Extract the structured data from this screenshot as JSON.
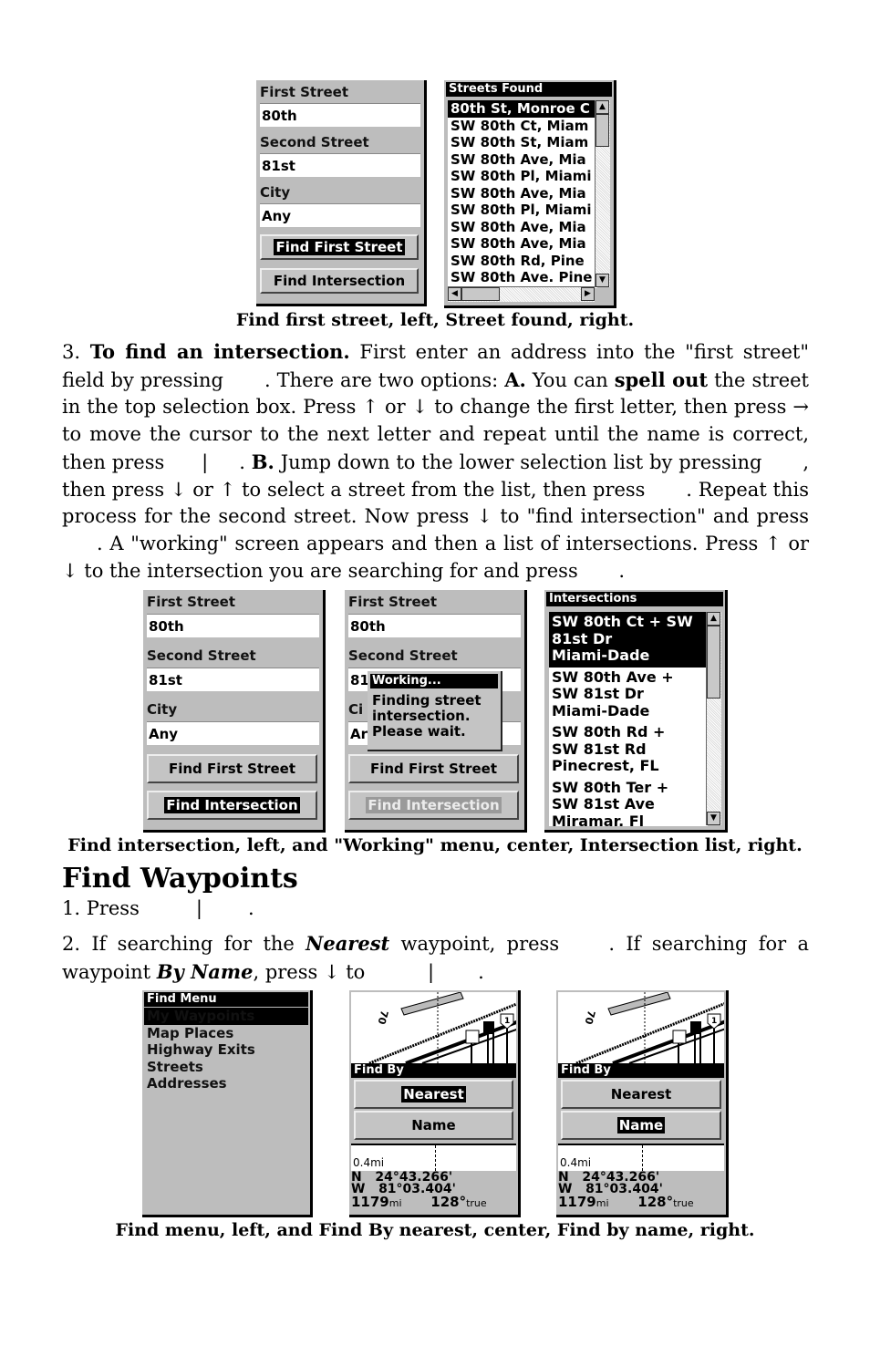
{
  "figure1": {
    "left_screen": {
      "first_street_label": "First Street",
      "first_street_value": "80th",
      "second_street_label": "Second Street",
      "second_street_value": "81st",
      "city_label": "City",
      "city_value": "Any",
      "find_first_street_button": "Find First Street",
      "find_intersection_button": "Find Intersection",
      "highlighted": "Find First Street"
    },
    "right_screen": {
      "title": "Streets Found",
      "items": [
        "80th St, Monroe C",
        "SW 80th Ct, Miam",
        "SW 80th St, Miam",
        "SW 80th Ave, Mia",
        "SW 80th Pl, Miami",
        "SW 80th Ave, Mia",
        "SW 80th Pl, Miami",
        "SW 80th Ave, Mia",
        "SW 80th Ave, Mia",
        "SW 80th Rd, Pine",
        "SW 80th Ave. Pine"
      ],
      "selected_index": 0
    },
    "caption": "Find first street, left, Street found, right."
  },
  "step3": {
    "number": "3.",
    "bold_intro": "To find an intersection.",
    "t1": " First enter an address into the \"first street\" field by pressing ",
    "t2": ". There are two options: ",
    "a_label": "A.",
    "t3": " You can ",
    "spell_out": "spell out",
    "t4": " the street in the top selection box. Press ↑ or ↓ to change the first letter, then press → to move the cursor to the next letter and repeat until the name is correct, then press ",
    "sep": "|",
    "t5": ". ",
    "b_label": "B.",
    "t6": " Jump down to the lower selection list by pressing ",
    "t7": ", then press ↓ or ↑ to select a street from the list, then press ",
    "t8": ". Repeat this process for the second street. Now press ↓ to \"find intersection\" and press ",
    "t9": ". A \"working\" screen appears and then a list of intersections. Press ↑ or ↓ to the intersection you are searching for and press ",
    "t10": "."
  },
  "figure2": {
    "left_screen": {
      "first_street_label": "First Street",
      "first_street_value": "80th",
      "second_street_label": "Second Street",
      "second_street_value": "81st",
      "city_label": "City",
      "city_value": "Any",
      "find_first_street_button": "Find First Street",
      "find_intersection_button": "Find Intersection",
      "highlighted": "Find Intersection"
    },
    "center_screen": {
      "first_street_label": "First Street",
      "first_street_value": "80th",
      "second_street_label": "Second Street",
      "second_street_value_partial": "81",
      "city_label_partial": "Ci",
      "city_value_partial": "Ar",
      "find_first_street_button": "Find First Street",
      "find_intersection_button": "Find Intersection",
      "dialog_title": "Working...",
      "dialog_lines": [
        "Finding street",
        "intersection.",
        "Please wait."
      ]
    },
    "right_screen": {
      "title": "Intersections",
      "items": [
        [
          "SW 80th Ct + SW",
          "81st Dr",
          "Miami-Dade"
        ],
        [
          "SW 80th Ave +",
          "SW 81st Dr",
          "Miami-Dade"
        ],
        [
          "SW 80th Rd +",
          "SW 81st Rd",
          "Pinecrest, FL"
        ],
        [
          "SW 80th Ter +",
          "SW 81st Ave",
          "Miramar, Fl"
        ]
      ],
      "selected_index": 0
    },
    "caption": "Find intersection, left, and \"Working\" menu, center, Intersection list, right."
  },
  "section": {
    "heading": "Find Waypoints",
    "step1_pre": "1. Press",
    "step1_sep": "|",
    "step1_end": ".",
    "step2_pre": "2. If searching for the ",
    "step2_nearest": "Nearest",
    "step2_mid": " waypoint, press ",
    "step2_mid2": ". If searching for a waypoint ",
    "step2_byname": "By Name",
    "step2_end": ", press ↓ to ",
    "step2_sep": "|",
    "step2_dot": "."
  },
  "figure3": {
    "left_screen": {
      "title": "Find Menu",
      "items": [
        "My Waypoints",
        "Map Places",
        "Highway Exits",
        "Streets",
        "Addresses"
      ],
      "selected_index": 0
    },
    "center_screen": {
      "map_label": "0.4mi",
      "find_by_title": "Find By",
      "options": [
        "Nearest",
        "Name"
      ],
      "selected": "Nearest",
      "lat": "N   24°43.266'",
      "lon": "W   81°03.404'",
      "distance": "1179",
      "distance_unit": "mi",
      "bearing": "128°",
      "bearing_unit": "true"
    },
    "right_screen": {
      "map_label": "0.4mi",
      "find_by_title": "Find By",
      "options": [
        "Nearest",
        "Name"
      ],
      "selected": "Name",
      "lat": "N   24°43.266'",
      "lon": "W   81°03.404'",
      "distance": "1179",
      "distance_unit": "mi",
      "bearing": "128°",
      "bearing_unit": "true"
    },
    "caption": "Find menu, left, and Find By nearest, center, Find by name, right."
  }
}
